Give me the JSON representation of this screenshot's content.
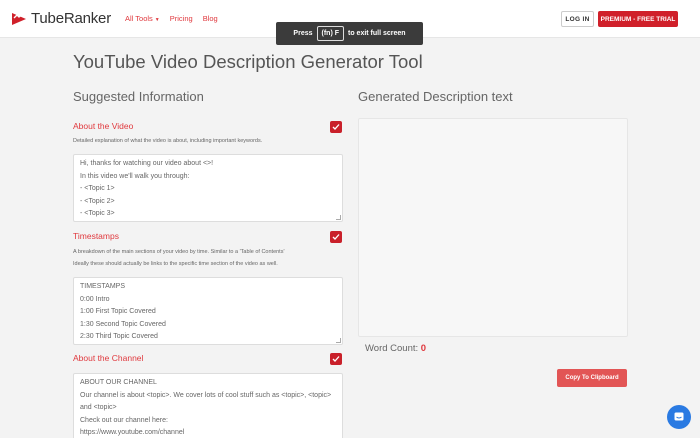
{
  "nav": {
    "logo_text": "TubeRanker",
    "links": [
      "All Tools",
      "Pricing",
      "Blog"
    ],
    "login_label": "LOG IN",
    "premium_label": "PREMIUM - FREE TRIAL"
  },
  "fullscreen_banner": {
    "press": "Press",
    "key": "(fn) F",
    "suffix": "to exit full screen"
  },
  "page_title": "YouTube Video Description Generator Tool",
  "left": {
    "heading": "Suggested Information",
    "fields": [
      {
        "label": "About the Video",
        "description": "Detailed explanation of what the video is about, including important keywords.",
        "lines": [
          "Hi, thanks for watching our video about <>!",
          "In this video we'll walk you through:",
          "- <Topic 1>",
          "- <Topic 2>",
          "- <Topic 3>"
        ]
      },
      {
        "label": "Timestamps",
        "description_1": "A breakdown of the main sections of your video by time. Similar to a 'Table of Contents'",
        "description_2": "Ideally these should actually be links to the specific time section of the video as well.",
        "lines": [
          "TIMESTAMPS",
          "0:00 Intro",
          "1:00 First Topic Covered",
          "1:30 Second Topic Covered",
          "2:30 Third Topic Covered"
        ]
      },
      {
        "label": "About the Channel",
        "lines": [
          "ABOUT OUR CHANNEL",
          "Our channel is about <topic>. We cover lots of cool stuff such as <topic>, <topic>",
          "and <topic>",
          "Check out our channel here:",
          "https://www.youtube.com/channel"
        ]
      }
    ]
  },
  "right": {
    "heading": "Generated Description text",
    "word_count_label": "Word Count:",
    "word_count_value": "0",
    "copy_label": "Copy To Clipboard"
  },
  "colors": {
    "accent": "#e0393e",
    "premium": "#d0202a",
    "chat": "#2a7ae2"
  }
}
